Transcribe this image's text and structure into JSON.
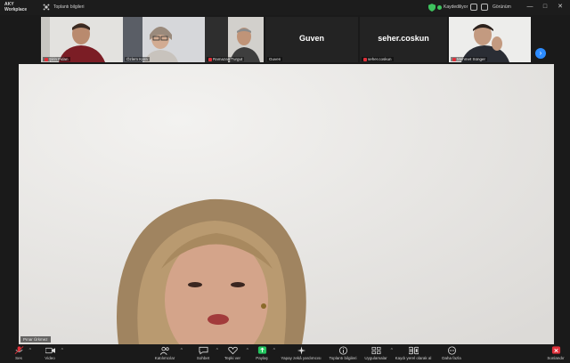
{
  "titlebar": {
    "brand_line1": "AKY",
    "brand_line2": "Workplace",
    "meeting_label": "Toplantı bilgileri",
    "recording_label": "Kaydediliyor",
    "view_label": "Görünüm",
    "minimize": "—",
    "maximize": "□",
    "close": "✕"
  },
  "participants": [
    {
      "name": "Şirin Fidan",
      "muted": true
    },
    {
      "name": "Özlem Kara",
      "muted": false
    },
    {
      "name": "Ramazan Turgut",
      "muted": true
    },
    {
      "name": "Guven",
      "caption": "Guven",
      "muted": false
    },
    {
      "name": "seher.coskun",
      "caption": "seher.coskun",
      "muted": true
    },
    {
      "name": "Mehmet Sünger",
      "muted": true
    }
  ],
  "speaker": {
    "name": "Pınar Ürkmez"
  },
  "toolbar": {
    "audio": "Ses",
    "video": "Video",
    "participants": "Katılımcılar",
    "chat": "Sohbet",
    "react": "Tepki ver",
    "share": "Paylaş",
    "ai_companion": "Yapay zekâ yardımcısı",
    "summary": "Toplantı bilgileri",
    "apps": "Uygulamalar",
    "record": "Kaydı yerel olarak al",
    "more": "Daha fazla",
    "end": "Sonlandır"
  },
  "colors": {
    "accent": "#2d8cff",
    "share_green": "#22c55e",
    "end_red": "#e0303a",
    "background": "#1a1a1a"
  }
}
